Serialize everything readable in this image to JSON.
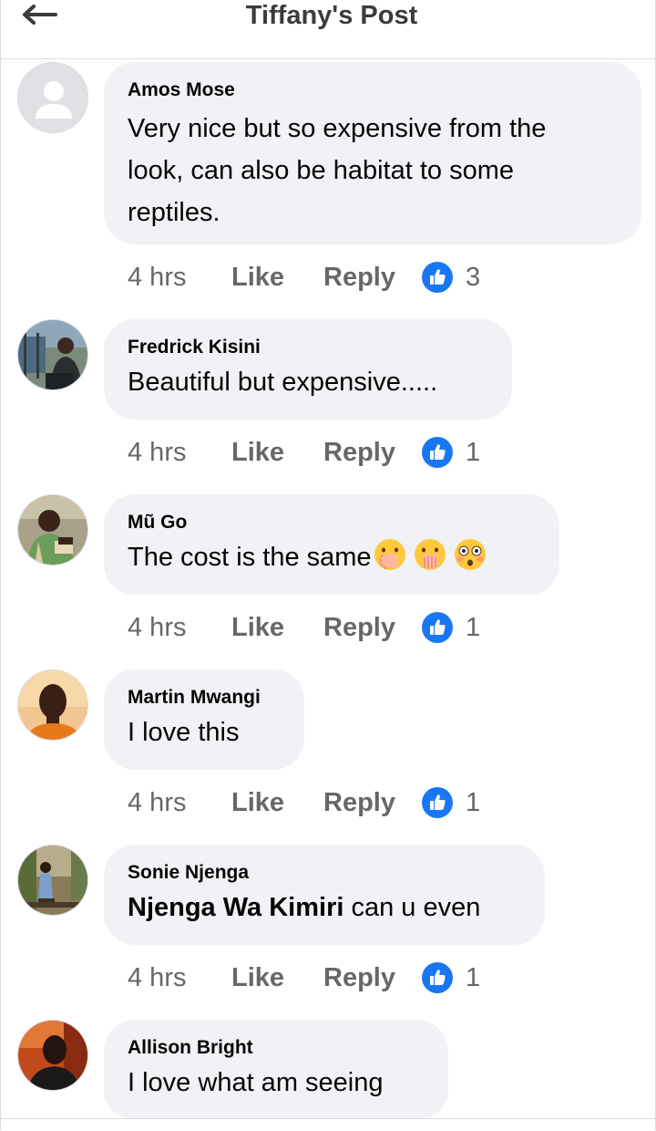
{
  "header": {
    "title": "Tiffany's Post",
    "back_icon": "arrow-left-icon"
  },
  "colors": {
    "bubble": "#f0f2f5",
    "meta_text": "#65676b",
    "like_blue": "#1877f2",
    "title_text": "#3a3b3c"
  },
  "comments": [
    {
      "author": "Amos Mose",
      "text_lines": [
        "Very nice but so expensive from the",
        "look, can also be habitat to some",
        "reptiles."
      ],
      "time": "4 hrs",
      "like": "Like",
      "reply": "Reply",
      "reactions": "3",
      "avatar": "default-avatar"
    },
    {
      "author": "Fredrick Kisini",
      "text": "Beautiful but expensive.....",
      "time": "4 hrs",
      "like": "Like",
      "reply": "Reply",
      "reactions": "1",
      "avatar": "photo-avatar"
    },
    {
      "author": "Mũ Go",
      "text": "The cost is the same",
      "emojis": [
        "hand-over-mouth-emoji",
        "hand-over-mouth-emoji",
        "flushed-face-emoji"
      ],
      "time": "4 hrs",
      "like": "Like",
      "reply": "Reply",
      "reactions": "1",
      "avatar": "photo-avatar"
    },
    {
      "author": "Martin Mwangi",
      "text": "I love this",
      "time": "4 hrs",
      "like": "Like",
      "reply": "Reply",
      "reactions": "1",
      "avatar": "photo-avatar"
    },
    {
      "author": "Sonie Njenga",
      "mention": "Njenga Wa Kimiri",
      "text": " can u even",
      "time": "4 hrs",
      "like": "Like",
      "reply": "Reply",
      "reactions": "1",
      "avatar": "photo-avatar"
    },
    {
      "author": "Allison Bright",
      "text": "I love what am seeing",
      "avatar": "photo-avatar"
    }
  ]
}
